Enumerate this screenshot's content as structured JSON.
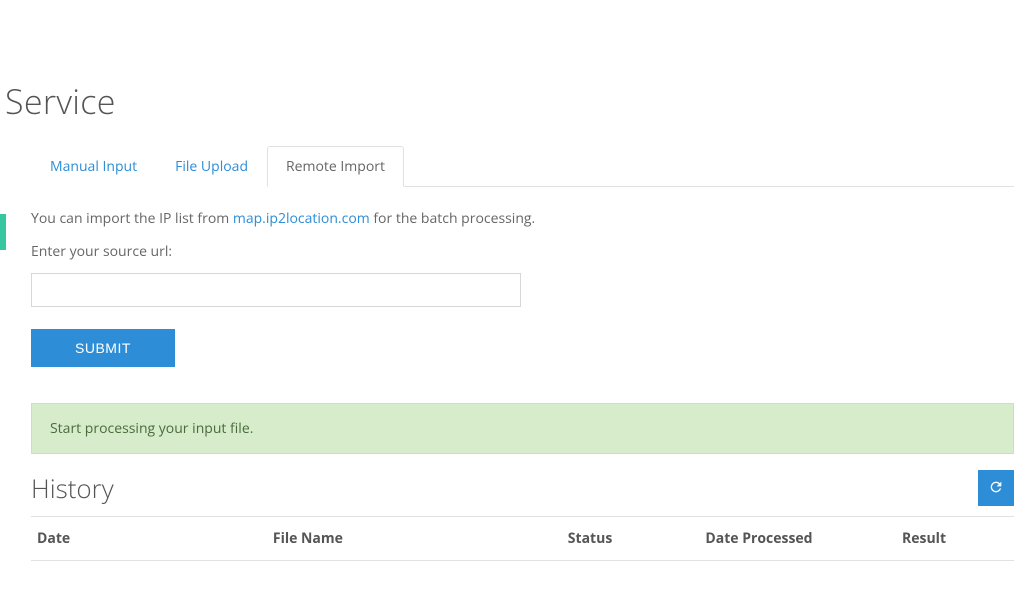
{
  "page_title": "Service",
  "tabs": [
    {
      "label": "Manual Input"
    },
    {
      "label": "File Upload"
    },
    {
      "label": "Remote Import"
    }
  ],
  "intro": {
    "prefix": "You can import the IP list from ",
    "link_text": "map.ip2location.com",
    "suffix": " for the batch processing."
  },
  "source_label": "Enter your source url:",
  "url_value": "",
  "submit_label": "SUBMIT",
  "alert_message": "Start processing your input file.",
  "history_title": "History",
  "columns": {
    "date": "Date",
    "file": "File Name",
    "status": "Status",
    "processed": "Date Processed",
    "result": "Result"
  }
}
